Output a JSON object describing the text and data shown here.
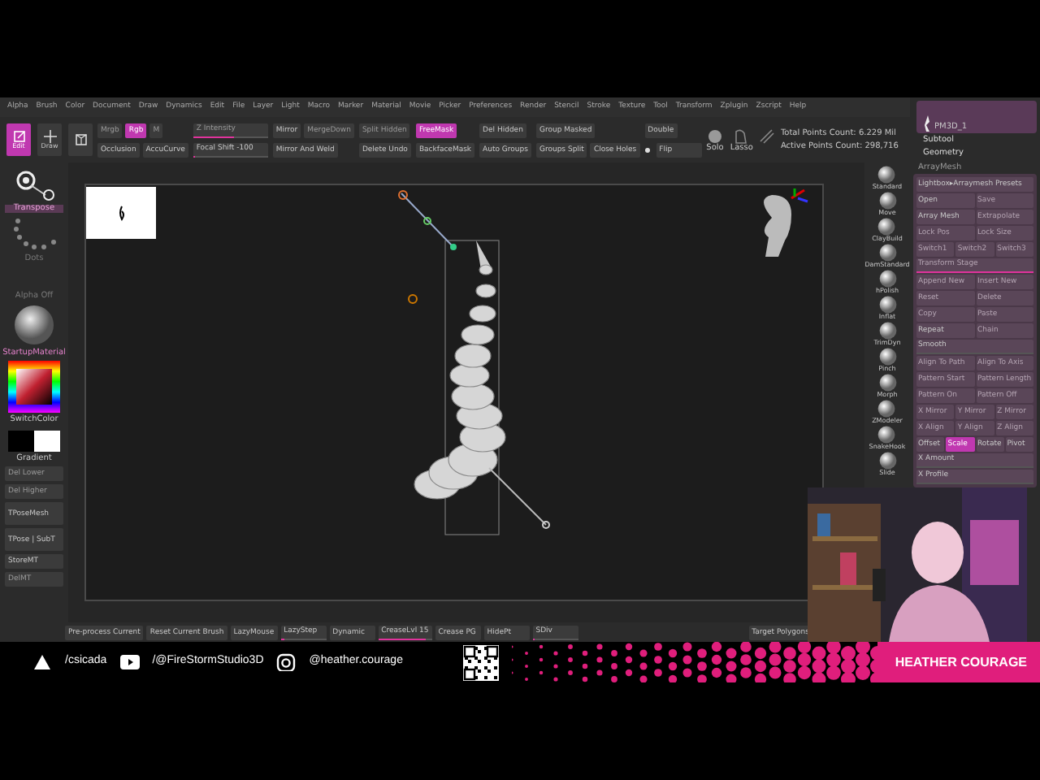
{
  "menu_bar": [
    "Alpha",
    "Brush",
    "Color",
    "Document",
    "Draw",
    "Dynamics",
    "Edit",
    "File",
    "Layer",
    "Light",
    "Macro",
    "Marker",
    "Material",
    "Movie",
    "Picker",
    "Preferences",
    "Render",
    "Stencil",
    "Stroke",
    "Texture",
    "Tool",
    "Transform",
    "Zplugin",
    "Zscript",
    "Help"
  ],
  "toolbar": {
    "modes": [
      {
        "kind": "edit",
        "label": "Edit",
        "selected": true
      },
      {
        "kind": "draw",
        "label": "Draw",
        "selected": false
      },
      {
        "kind": "gizmo",
        "selected": false
      }
    ],
    "columns": [
      [
        [
          {
            "kind": "button",
            "label": "Mrgb",
            "on": false,
            "disabled": true
          },
          {
            "kind": "button",
            "label": "Rgb",
            "on": true,
            "disabled": false
          },
          {
            "kind": "button",
            "label": "M",
            "on": false,
            "disabled": true
          }
        ],
        [
          {
            "kind": "button",
            "label": "Occlusion",
            "on": false,
            "disabled": false
          },
          {
            "kind": "button",
            "label": "AccuCurve",
            "on": false,
            "disabled": false
          }
        ]
      ],
      [
        [
          {
            "kind": "slider",
            "label": "Z Intensity",
            "level": 0.55,
            "disabled": true
          }
        ],
        [
          {
            "kind": "slider",
            "label": "Focal Shift -100",
            "level": 0.02,
            "disabled": false
          }
        ]
      ],
      [
        [
          {
            "kind": "button",
            "label": "Mirror",
            "on": false,
            "disabled": false
          },
          {
            "kind": "button",
            "label": "MergeDown",
            "on": false,
            "disabled": true
          }
        ],
        [
          {
            "kind": "button",
            "label": "Mirror And Weld",
            "on": false,
            "disabled": false
          }
        ]
      ],
      [
        [
          {
            "kind": "button",
            "label": "Split Hidden",
            "on": false,
            "disabled": true
          }
        ],
        [
          {
            "kind": "button",
            "label": "Delete Undo",
            "on": false,
            "disabled": false
          }
        ]
      ],
      [
        [
          {
            "kind": "button",
            "label": "FreeMask",
            "on": true,
            "disabled": false
          }
        ],
        [
          {
            "kind": "button",
            "label": "BackfaceMask",
            "on": false,
            "disabled": false
          }
        ]
      ],
      [
        [
          {
            "kind": "button",
            "label": "Del Hidden",
            "on": false,
            "disabled": false
          }
        ],
        [
          {
            "kind": "button",
            "label": "Auto Groups",
            "on": false,
            "disabled": false
          }
        ]
      ],
      [
        [
          {
            "kind": "button",
            "label": "Group Masked",
            "on": false,
            "disabled": false
          }
        ],
        [
          {
            "kind": "button",
            "label": "Groups Split",
            "on": false,
            "disabled": false
          },
          {
            "kind": "button",
            "label": "Close Holes",
            "on": false,
            "disabled": false
          }
        ]
      ],
      [
        [
          {
            "kind": "button",
            "label": "Double",
            "on": false,
            "disabled": false
          }
        ],
        [
          {
            "kind": "check",
            "label": "Flip",
            "checked": true
          }
        ]
      ]
    ],
    "tools": [
      {
        "kind": "solo",
        "label": "Solo"
      },
      {
        "kind": "lasso",
        "label": "Lasso"
      },
      {
        "kind": "stroke"
      }
    ],
    "stats": [
      "Total Points Count: 6.229 Mil",
      "Active Points Count: 298,716"
    ]
  },
  "tool_thumbnail": {
    "label": "PM3D_1"
  },
  "right_panel": {
    "headers": [
      "Subtool",
      "Geometry"
    ],
    "section": "ArrayMesh",
    "rows": [
      [
        {
          "kind": "button",
          "label": "Lightbox▸Arraymesh Presets",
          "on": false,
          "disabled": false
        }
      ],
      [
        {
          "kind": "button",
          "label": "Open",
          "on": false,
          "disabled": false
        },
        {
          "kind": "button",
          "label": "Save",
          "on": false,
          "disabled": true
        }
      ],
      [
        {
          "kind": "button",
          "label": "Array Mesh",
          "on": false,
          "disabled": false
        },
        {
          "kind": "button",
          "label": "Extrapolate",
          "on": false,
          "disabled": true
        }
      ],
      [
        {
          "kind": "button",
          "label": "Lock Pos",
          "on": false,
          "disabled": true
        },
        {
          "kind": "button",
          "label": "Lock Size",
          "on": false,
          "disabled": true
        }
      ],
      [
        {
          "kind": "button",
          "label": "Switch1",
          "on": false,
          "disabled": true
        },
        {
          "kind": "button",
          "label": "Switch2",
          "on": false,
          "disabled": true
        },
        {
          "kind": "button",
          "label": "Switch3",
          "on": false,
          "disabled": true
        }
      ],
      [
        {
          "kind": "slider",
          "label": "Transform Stage",
          "level": 1,
          "disabled": true
        }
      ],
      [
        {
          "kind": "button",
          "label": "Append New",
          "on": false,
          "disabled": true
        },
        {
          "kind": "button",
          "label": "Insert New",
          "on": false,
          "disabled": true
        }
      ],
      [
        {
          "kind": "button",
          "label": "Reset",
          "on": false,
          "disabled": true
        },
        {
          "kind": "button",
          "label": "Delete",
          "on": false,
          "disabled": true
        }
      ],
      [
        {
          "kind": "button",
          "label": "Copy",
          "on": false,
          "disabled": true
        },
        {
          "kind": "button",
          "label": "Paste",
          "on": false,
          "disabled": true
        }
      ],
      [
        {
          "kind": "button",
          "label": "Repeat",
          "on": false,
          "disabled": false
        },
        {
          "kind": "button",
          "label": "Chain",
          "on": false,
          "disabled": true
        }
      ],
      [
        {
          "kind": "slider",
          "label": "Smooth",
          "disabled": false
        }
      ],
      [
        {
          "kind": "button",
          "label": "Align To Path",
          "on": false,
          "disabled": true
        },
        {
          "kind": "button",
          "label": "Align To Axis",
          "on": false,
          "disabled": true
        }
      ],
      [
        {
          "kind": "button",
          "label": "Pattern Start",
          "on": false,
          "disabled": true
        },
        {
          "kind": "button",
          "label": "Pattern Length",
          "on": false,
          "disabled": true
        }
      ],
      [
        {
          "kind": "button",
          "label": "Pattern On",
          "on": false,
          "disabled": true
        },
        {
          "kind": "button",
          "label": "Pattern Off",
          "on": false,
          "disabled": true
        }
      ],
      [
        {
          "kind": "button",
          "label": "X Mirror",
          "on": false,
          "disabled": true
        },
        {
          "kind": "button",
          "label": "Y Mirror",
          "on": false,
          "disabled": true
        },
        {
          "kind": "button",
          "label": "Z Mirror",
          "on": false,
          "disabled": true
        }
      ],
      [
        {
          "kind": "button",
          "label": "X Align",
          "on": false,
          "disabled": true
        },
        {
          "kind": "button",
          "label": "Y Align",
          "on": false,
          "disabled": true
        },
        {
          "kind": "button",
          "label": "Z Align",
          "on": false,
          "disabled": true
        }
      ],
      [
        {
          "kind": "button",
          "label": "Offset",
          "on": false,
          "disabled": false
        },
        {
          "kind": "button",
          "label": "Scale",
          "on": true,
          "disabled": false
        },
        {
          "kind": "button",
          "label": "Rotate",
          "on": false,
          "disabled": false
        },
        {
          "kind": "button",
          "label": "Pivot",
          "on": false,
          "disabled": false
        }
      ],
      [
        {
          "kind": "slider",
          "label": "X Amount",
          "disabled": false
        }
      ],
      [
        {
          "kind": "slider",
          "label": "X Profile",
          "disabled": false
        }
      ]
    ]
  },
  "brush_shelf": [
    "Standard",
    "Move",
    "ClayBuild",
    "DamStandard",
    "hPolish",
    "Inflat",
    "TrimDyn",
    "Pinch",
    "Morph",
    "ZModeler",
    "SnakeHook",
    "Slide"
  ],
  "left_panel": [
    {
      "kind": "transpose",
      "label": "Transpose"
    },
    {
      "kind": "dots",
      "label": "Dots"
    },
    {
      "kind": "caption",
      "label": "Alpha Off"
    },
    {
      "kind": "material",
      "label": "StartupMaterial"
    },
    {
      "kind": "color",
      "label": "SwitchColor"
    },
    {
      "kind": "swatches",
      "label": "Gradient"
    },
    {
      "kind": "button",
      "label": "Del Lower",
      "disabled": true
    },
    {
      "kind": "button",
      "label": "Del Higher",
      "disabled": true
    },
    {
      "kind": "bigbutton",
      "label": "TPoseMesh"
    },
    {
      "kind": "bigbutton",
      "label": "TPose | SubT"
    },
    {
      "kind": "button",
      "label": "StoreMT",
      "disabled": false
    },
    {
      "kind": "button",
      "label": "DelMT",
      "disabled": true
    }
  ],
  "bottom_bar": [
    {
      "kind": "button",
      "label": "Pre-process Current"
    },
    {
      "kind": "button",
      "label": "Reset Current Brush"
    },
    {
      "kind": "button",
      "label": "LazyMouse"
    },
    {
      "kind": "slider",
      "label": "LazyStep",
      "level": 0.1
    },
    {
      "kind": "button",
      "label": "Dynamic"
    },
    {
      "kind": "slider",
      "label": "CreaseLvl 15",
      "level": 0.9
    },
    {
      "kind": "button",
      "label": "Crease PG"
    },
    {
      "kind": "button",
      "label": "HidePt"
    },
    {
      "kind": "slider",
      "label": "SDiv",
      "level": 0.05
    },
    {
      "kind": "button",
      "label": "Target Polygons"
    }
  ],
  "overlay": {
    "links": [
      {
        "kind": "artstation",
        "label": "/csicada"
      },
      {
        "kind": "youtube",
        "label": "/@FireStormStudio3D"
      },
      {
        "kind": "instagram",
        "label": "@heather.courage"
      }
    ],
    "name": "HEATHER COURAGE"
  }
}
